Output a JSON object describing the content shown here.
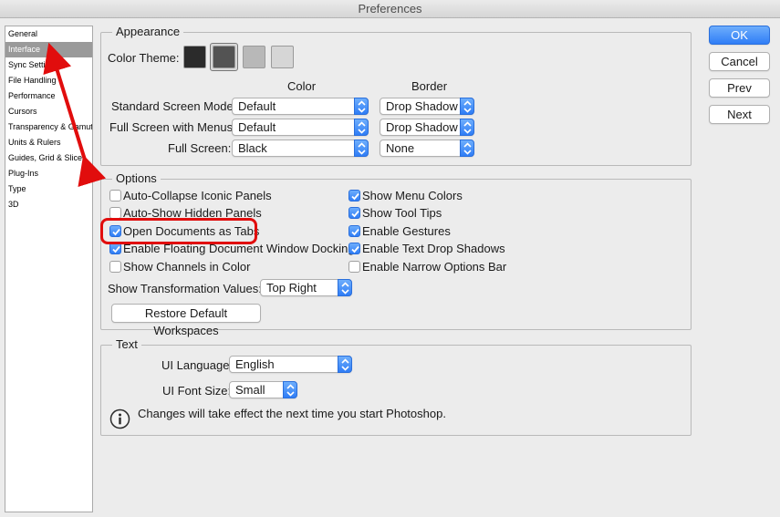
{
  "window": {
    "title": "Preferences"
  },
  "sidebar": {
    "items": [
      {
        "label": "General"
      },
      {
        "label": "Interface"
      },
      {
        "label": "Sync Settings"
      },
      {
        "label": "File Handling"
      },
      {
        "label": "Performance"
      },
      {
        "label": "Cursors"
      },
      {
        "label": "Transparency & Gamut"
      },
      {
        "label": "Units & Rulers"
      },
      {
        "label": "Guides, Grid & Slices"
      },
      {
        "label": "Plug-Ins"
      },
      {
        "label": "Type"
      },
      {
        "label": "3D"
      }
    ],
    "selected": "Interface"
  },
  "appearance": {
    "title": "Appearance",
    "color_theme_label": "Color Theme:",
    "themes": [
      {
        "name": "darkest",
        "color": "#2b2b2b"
      },
      {
        "name": "dark",
        "color": "#535353"
      },
      {
        "name": "light",
        "color": "#b8b8b8"
      },
      {
        "name": "lightest",
        "color": "#d6d6d6"
      }
    ],
    "selected_theme": "dark",
    "color_header": "Color",
    "border_header": "Border",
    "standard_label": "Standard Screen Mode:",
    "standard_color": "Default",
    "standard_border": "Drop Shadow",
    "fullmenus_label": "Full Screen with Menus:",
    "fullmenus_color": "Default",
    "fullmenus_border": "Drop Shadow",
    "full_label": "Full Screen:",
    "full_color": "Black",
    "full_border": "None"
  },
  "options": {
    "title": "Options",
    "left": [
      {
        "label": "Auto-Collapse Iconic Panels",
        "checked": false
      },
      {
        "label": "Auto-Show Hidden Panels",
        "checked": false
      },
      {
        "label": "Open Documents as Tabs",
        "checked": true
      },
      {
        "label": "Enable Floating Document Window Docking",
        "checked": true
      },
      {
        "label": "Show Channels in Color",
        "checked": false
      }
    ],
    "right": [
      {
        "label": "Show Menu Colors",
        "checked": true
      },
      {
        "label": "Show Tool Tips",
        "checked": true
      },
      {
        "label": "Enable Gestures",
        "checked": true
      },
      {
        "label": "Enable Text Drop Shadows",
        "checked": true
      },
      {
        "label": "Enable Narrow Options Bar",
        "checked": false
      }
    ],
    "transform_label": "Show Transformation Values:",
    "transform_value": "Top Right",
    "restore_button": "Restore Default Workspaces"
  },
  "text_group": {
    "title": "Text",
    "ui_language_label": "UI Language:",
    "ui_language_value": "English",
    "ui_font_size_label": "UI Font Size:",
    "ui_font_size_value": "Small",
    "info_message": "Changes will take effect the next time you start Photoshop."
  },
  "buttons": {
    "ok": "OK",
    "cancel": "Cancel",
    "prev": "Prev",
    "next": "Next"
  },
  "annotation": {
    "color": "#e10d0d"
  }
}
